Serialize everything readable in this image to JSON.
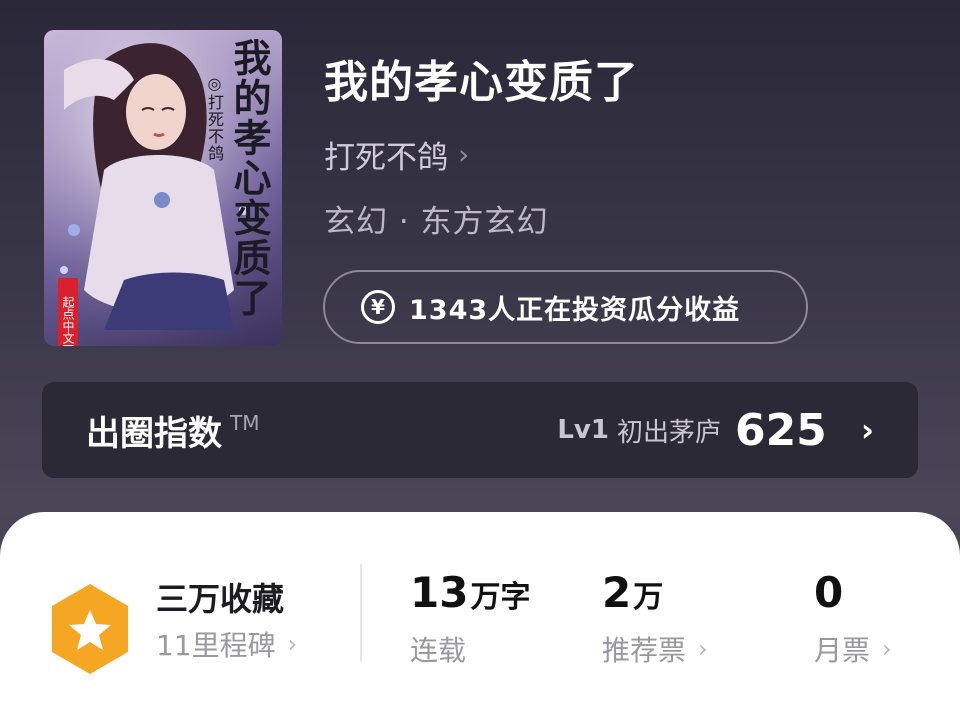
{
  "book": {
    "title": "我的孝心变质了",
    "author": "打死不鸽",
    "genre": "玄幻 · 东方玄幻",
    "invest_text": "1343人正在投资瓜分收益",
    "invest_icon": "yen-icon"
  },
  "cover": {
    "title_text": "我的孝心变质了",
    "author_text": "◎打死不鸽",
    "logo_text": "起点中文网"
  },
  "index": {
    "title": "出圈指数",
    "tm": "TM",
    "level": "Lv1",
    "level_name": "初出茅庐",
    "score": "625"
  },
  "stats": {
    "favorites": {
      "title": "三万收藏",
      "sub": "11里程碑"
    },
    "words": {
      "num": "13",
      "unit": "万字",
      "label": "连载"
    },
    "recommend": {
      "num": "2",
      "unit": "万",
      "label": "推荐票"
    },
    "monthly": {
      "num": "0",
      "unit": "",
      "label": "月票"
    }
  },
  "colors": {
    "badge": "#f5a623",
    "background_top": "#2a2838",
    "panel": "#ffffff"
  }
}
